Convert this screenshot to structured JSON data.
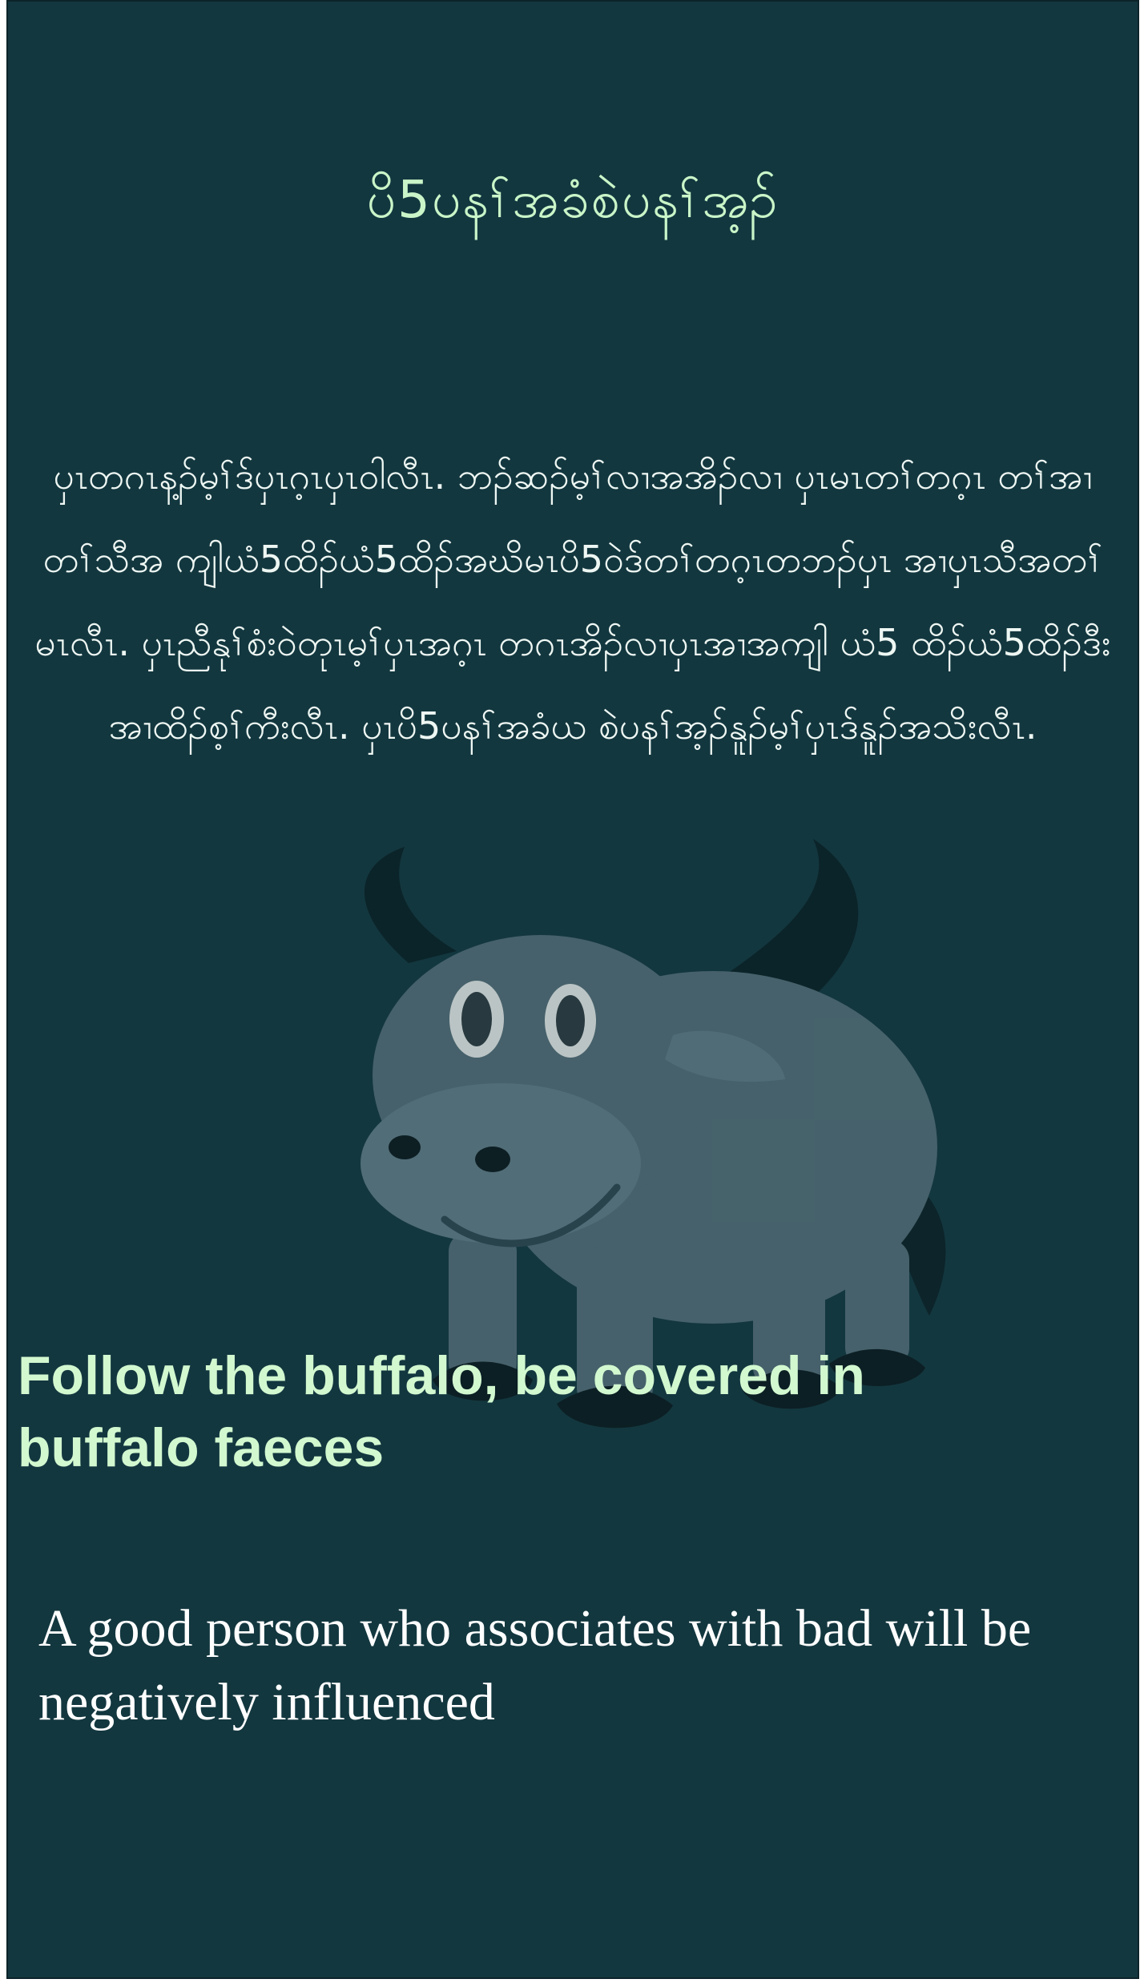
{
  "proverb": {
    "title": "ပိ5ပနၢ်အခံစဲပနၢ်အ့ၣ်",
    "local_text": "ပှၤတဂၤန့ၣ်မ့ၢ်ဒ်ပှၤဂ့ၤပှၤဝါလီၤ. ဘၣ်ဆၣ်မ့ၢ်လၢအအိၣ်လၢ ပှၤမၤတၢ်တဂ့ၤ တၢ်အၢတၢ်သီအ ကျါယံ5ထိၣ်ယံ5ထိၣ်အဃိမၤပိ5ဝဲဒ်တၢ်တဂ့ၤတဘၣ်ပှၤ အၢပှၤသီအတၢ်မၤလီၤ. ပှၤညီနုၢ်စံးဝဲတုၤမ့ၢ်ပှၤအဂ့ၤ တဂၤအိၣ်လၢပှၤအၢအကျါ ယံ5 ထိၣ်ယံ5ထိၣ်ဒီးအၢထိၣ်စ့ၢ်ကီးလီၤ. ပှၤပိ5ပနၢ်အခံယ စဲပနၢ်အ့ၣ်နူၣ်မ့ၢ်ပှၤဒ်နူၣ်အသိးလီၤ.",
    "english_title": "Follow the buffalo, be covered in buffalo faeces",
    "meaning": "A good person who associates with bad will be negatively influenced"
  },
  "colors": {
    "background": "#13373f",
    "title": "#c9f5c8",
    "body_text": "#eef7f3",
    "english_title": "#d2f8d0",
    "meaning": "#ffffff"
  },
  "illustration": {
    "icon": "buffalo-icon"
  }
}
